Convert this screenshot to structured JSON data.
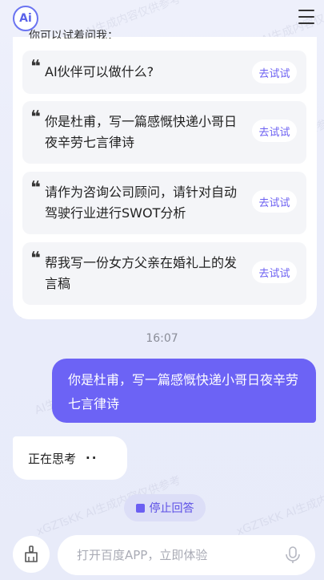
{
  "header": {
    "logo_text": "Ai",
    "menu_icon": "hamburger-menu-icon"
  },
  "card": {
    "heading": "你可以试着问我：",
    "suggestions": [
      {
        "text": "AI伙伴可以做什么?",
        "action": "去试试"
      },
      {
        "text": "你是杜甫，写一篇感慨快递小哥日夜辛劳七言律诗",
        "action": "去试试"
      },
      {
        "text": "请作为咨询公司顾问，请针对自动驾驶行业进行SWOT分析",
        "action": "去试试"
      },
      {
        "text": "帮我写一份女方父亲在婚礼上的发言稿",
        "action": "去试试"
      }
    ]
  },
  "chat": {
    "time": "16:07",
    "user_message": "你是杜甫，写一篇感慨快递小哥日夜辛劳七言律诗",
    "bot_status": "正在思考",
    "bot_dots": "··"
  },
  "controls": {
    "stop_label": "停止回答",
    "input_placeholder": "打开百度APP，立即体验",
    "clean_icon": "broom-icon",
    "mic_icon": "microphone-icon"
  },
  "colors": {
    "accent": "#6c63f5",
    "background": "#eef0fb"
  }
}
